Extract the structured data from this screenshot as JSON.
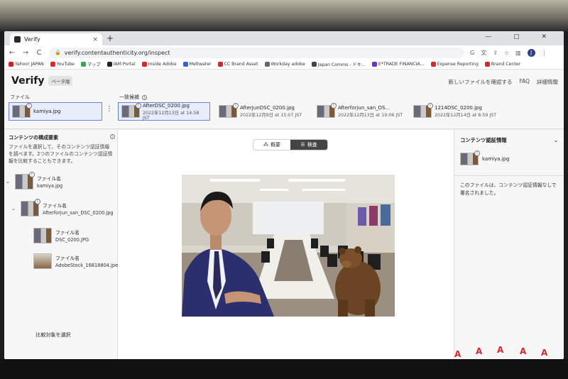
{
  "browser": {
    "tab_title": "Verify",
    "tab_close": "×",
    "new_tab": "+",
    "window_controls": "— ▢ ✕",
    "nav": {
      "back": "←",
      "forward": "→",
      "reload": "C"
    },
    "lock_icon": "🔒",
    "url": "verify.contentauthenticity.org/inspect",
    "toolbar_icons": {
      "google": "G",
      "translate": "文",
      "share": "⇪",
      "star": "☆",
      "split": "▥",
      "profile": "J",
      "menu": "⋮"
    }
  },
  "bookmarks": [
    {
      "label": "Yahoo! JAPAN",
      "color": "#cc2222"
    },
    {
      "label": "YouTube",
      "color": "#ee2222"
    },
    {
      "label": "マップ",
      "color": "#3aa757"
    },
    {
      "label": "IAM Portal",
      "color": "#222222"
    },
    {
      "label": "Inside Adobe",
      "color": "#d8262b"
    },
    {
      "label": "Meltwater",
      "color": "#3366cc"
    },
    {
      "label": "CC Brand Asset",
      "color": "#d8262b"
    },
    {
      "label": "Workday adobe",
      "color": "#666666"
    },
    {
      "label": "Japan Comms - ドキ...",
      "color": "#444444"
    },
    {
      "label": "E*TRADE FINANCIA...",
      "color": "#6633cc"
    },
    {
      "label": "Expense Reporting",
      "color": "#d8262b"
    },
    {
      "label": "Brand Center",
      "color": "#d8262b"
    }
  ],
  "app": {
    "logo": "Verify",
    "beta": "ベータ版",
    "links": [
      "新しいファイルを確認する",
      "FAQ",
      "詳細情報"
    ]
  },
  "files": {
    "file_label": "ファイル",
    "selected_file": "kamiya.jpg",
    "more": "⋮",
    "related_label": "一致候補",
    "info": "i",
    "candidates": [
      {
        "name": "AfterDSC_0200.jpg",
        "date": "2022年12月13日 at 14:58 JST"
      },
      {
        "name": "AfterJunDSC_0200.jpg",
        "date": "2022年12月9日 at 15:07 JST"
      },
      {
        "name": "Afterforjun_san_DS...",
        "date": "2022年12月13日 at 19:06 JST"
      },
      {
        "name": "1214DSC_0200.jpg",
        "date": "2022年12月14日 at 8:59 JST"
      }
    ]
  },
  "left": {
    "title": "コンテンツの構成要素",
    "desc": "ファイルを選択して、そのコンテンツ認証情報を調べます。2つのファイルのコンテンツ認証情報を比較することもできます。",
    "tree": [
      {
        "label": "ファイル名",
        "value": "kamiya.jpg"
      },
      {
        "label": "ファイル名",
        "value": "Afterforjun_san_DSC_0200.jpg"
      },
      {
        "label": "ファイル名",
        "value": "DSC_0200.JPG"
      },
      {
        "label": "ファイル名",
        "value": "AdobeStock_16818804.jpeg"
      }
    ],
    "caret": "⌄",
    "compare_button": "比較対象を選択"
  },
  "center": {
    "tab_overview": "概要",
    "tab_inspect": "検査"
  },
  "right": {
    "title": "コンテンツ認証情報",
    "chevron": "⌄",
    "file": "kamiya.jpg",
    "note": "このファイルは、コンテンツ認証情報なしで署名されました。"
  },
  "colors": {
    "accent": "#6b84d8",
    "adobe_red": "#d8262b"
  }
}
